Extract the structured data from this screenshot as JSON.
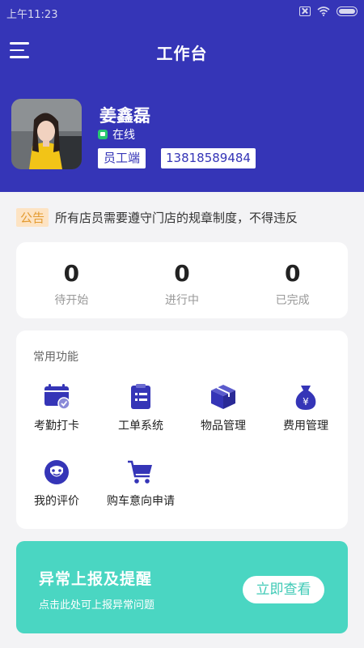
{
  "status_bar": {
    "time": "上午11:23"
  },
  "header": {
    "title": "工作台"
  },
  "profile": {
    "name": "姜鑫磊",
    "status": "在线",
    "role": "员工端",
    "phone": "13818589484"
  },
  "notice": {
    "tag": "公告",
    "text": "所有店员需要遵守门店的规章制度，不得违反"
  },
  "stats": [
    {
      "value": "0",
      "label": "待开始"
    },
    {
      "value": "0",
      "label": "进行中"
    },
    {
      "value": "0",
      "label": "已完成"
    }
  ],
  "features": {
    "title": "常用功能",
    "items": [
      {
        "label": "考勤打卡",
        "icon": "calendar-check-icon"
      },
      {
        "label": "工单系统",
        "icon": "clipboard-icon"
      },
      {
        "label": "物品管理",
        "icon": "box-icon"
      },
      {
        "label": "费用管理",
        "icon": "money-bag-icon"
      },
      {
        "label": "我的评价",
        "icon": "smiley-icon"
      },
      {
        "label": "购车意向申请",
        "icon": "cart-icon"
      }
    ]
  },
  "alert": {
    "title": "异常上报及提醒",
    "subtitle": "点击此处可上报异常问题",
    "button": "立即查看"
  },
  "colors": {
    "primary": "#3535b7",
    "accent": "#4ad6c2",
    "online": "#28c76f",
    "notice_tag_bg": "#fde3c3",
    "notice_tag_text": "#e39b32"
  }
}
